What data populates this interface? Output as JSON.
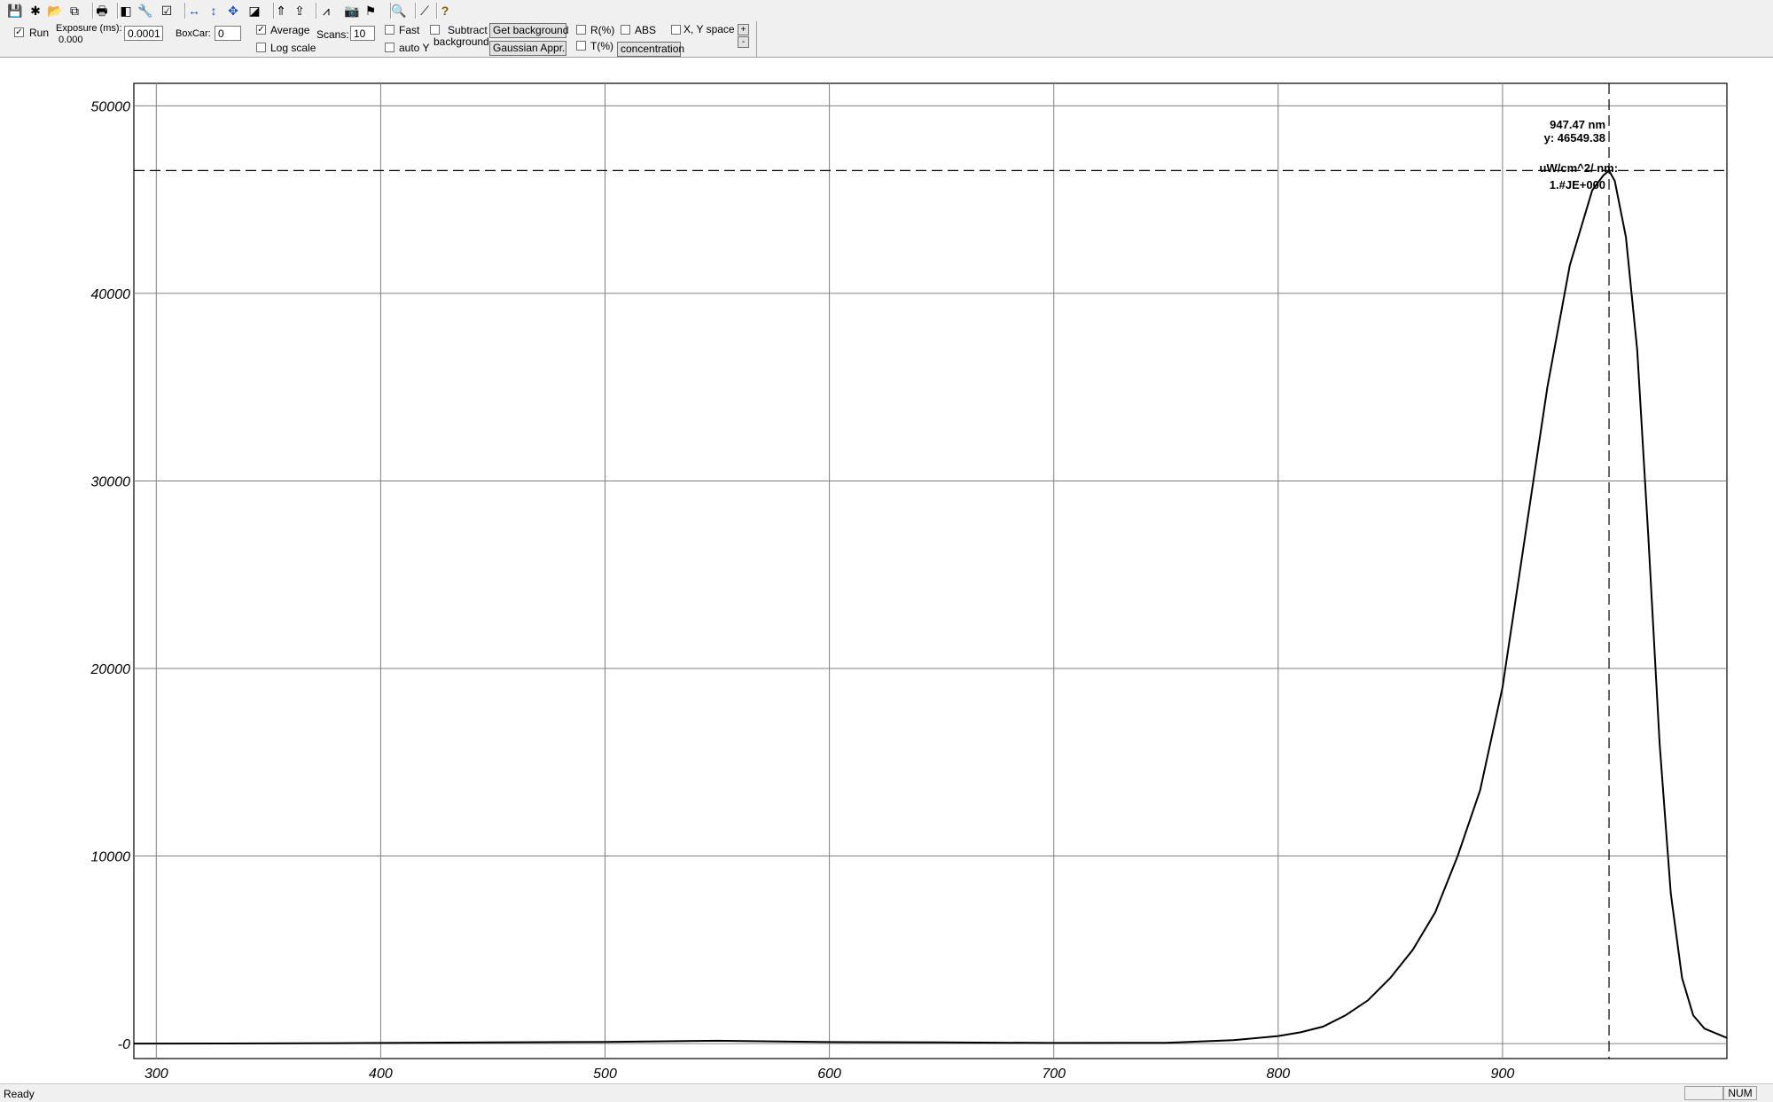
{
  "toolbar": {
    "icons": [
      {
        "name": "save-icon",
        "glyph": "💾"
      },
      {
        "name": "new-spectrum-icon",
        "glyph": "✱"
      },
      {
        "name": "open-folder-icon",
        "glyph": "📂"
      },
      {
        "name": "copy-icon",
        "glyph": "⧉"
      },
      {
        "name": "print-icon",
        "glyph": "🖶"
      },
      {
        "name": "device-icon",
        "glyph": "◧"
      },
      {
        "name": "wrench-icon",
        "glyph": "🔧"
      },
      {
        "name": "checkmark-box-icon",
        "glyph": "☑"
      },
      {
        "name": "horizontal-arrows-icon",
        "glyph": "↔"
      },
      {
        "name": "vertical-arrows-icon",
        "glyph": "↕"
      },
      {
        "name": "move-arrows-icon",
        "glyph": "✥"
      },
      {
        "name": "chart-zoom-icon",
        "glyph": "◪"
      },
      {
        "name": "peak-up-icon",
        "glyph": "⇑"
      },
      {
        "name": "folder-arrow-icon",
        "glyph": "⇪"
      },
      {
        "name": "spectrum-peaks-icon",
        "glyph": "⩘"
      },
      {
        "name": "camera-icon",
        "glyph": "📷"
      },
      {
        "name": "flag-icon",
        "glyph": "⚑"
      },
      {
        "name": "magnify-icon",
        "glyph": "🔍"
      },
      {
        "name": "line-fit-icon",
        "glyph": "⟋"
      },
      {
        "name": "help-icon",
        "glyph": "?"
      }
    ]
  },
  "controls": {
    "run_label": "Run",
    "run_checked": true,
    "exposure_label": "Exposure (ms):",
    "exposure_current": "0.000",
    "exposure_value": "0.0001",
    "boxcar_label": "BoxCar:",
    "boxcar_value": "0",
    "average_label": "Average",
    "average_checked": true,
    "logscale_label": "Log scale",
    "scans_label": "Scans:",
    "scans_value": "10",
    "fast_label": "Fast",
    "autoy_label": "auto Y",
    "subtract_label_1": "Subtract",
    "subtract_label_2": "background",
    "get_background_label": "Get background",
    "gaussian_label": "Gaussian Appr.",
    "r_label": "R(%)",
    "t_label": "T(%)",
    "abs_label": "ABS",
    "concentration_label": "concentration",
    "xy_space_label": "X, Y space",
    "spin_up": "+",
    "spin_down": "-"
  },
  "cursor": {
    "x_text": "947.47 nm",
    "y_text": "y: 46549.38",
    "unit_text": "uW/cm^2/ nm:",
    "value_text": "1.#JE+000"
  },
  "chart_data": {
    "type": "line",
    "title": "",
    "xlabel": "",
    "ylabel": "",
    "xlim": [
      290,
      1000
    ],
    "ylim": [
      -800,
      51200
    ],
    "x_ticks": [
      300,
      400,
      500,
      600,
      700,
      800,
      900
    ],
    "y_ticks": [
      0,
      10000,
      20000,
      30000,
      40000,
      50000
    ],
    "y_tick_labels": [
      "-0",
      "10000",
      "20000",
      "30000",
      "40000",
      "50000"
    ],
    "grid": true,
    "cursor_x": 947.47,
    "cursor_y": 46549.38,
    "series": [
      {
        "x": [
          290,
          350,
          400,
          450,
          500,
          550,
          600,
          650,
          700,
          750,
          780,
          800,
          810,
          820,
          830,
          840,
          850,
          860,
          870,
          880,
          890,
          900,
          910,
          920,
          930,
          940,
          945,
          947.47,
          950,
          955,
          960,
          965,
          970,
          975,
          980,
          985,
          990,
          1000
        ],
        "y": [
          0,
          10,
          30,
          60,
          90,
          150,
          80,
          60,
          30,
          40,
          180,
          400,
          600,
          900,
          1500,
          2300,
          3500,
          5000,
          7000,
          10000,
          13500,
          19000,
          27000,
          35000,
          41500,
          45500,
          46300,
          46549,
          46000,
          43000,
          37000,
          27000,
          16000,
          8000,
          3500,
          1500,
          800,
          300
        ]
      }
    ]
  },
  "status": {
    "text": "Ready",
    "num": "NUM"
  }
}
